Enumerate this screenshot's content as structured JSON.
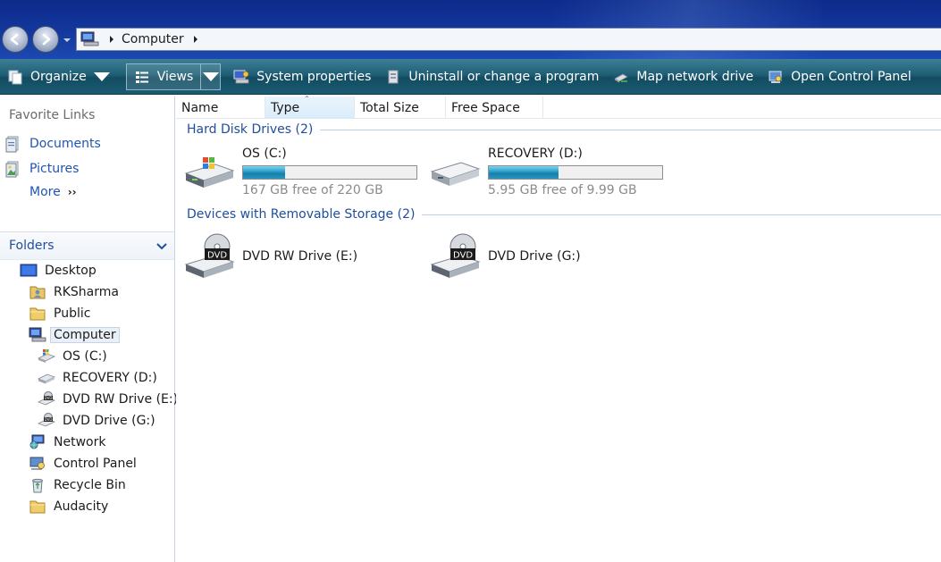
{
  "address": {
    "crumbs": [
      "Computer"
    ]
  },
  "toolbar": {
    "organize": "Organize",
    "views": "Views",
    "system_properties": "System properties",
    "uninstall": "Uninstall or change a program",
    "map_network": "Map network drive",
    "open_control_panel": "Open Control Panel"
  },
  "favorites": {
    "title": "Favorite Links",
    "items": [
      {
        "label": "Documents",
        "icon": "documents-icon"
      },
      {
        "label": "Pictures",
        "icon": "pictures-icon"
      }
    ],
    "more": "More"
  },
  "folders": {
    "title": "Folders",
    "tree": [
      {
        "label": "Desktop",
        "icon": "desktop-icon"
      },
      {
        "label": "RKSharma",
        "icon": "user-folder-icon"
      },
      {
        "label": "Public",
        "icon": "folder-icon"
      },
      {
        "label": "Computer",
        "icon": "computer-icon",
        "selected": true
      },
      {
        "label": "OS (C:)",
        "icon": "os-drive-icon"
      },
      {
        "label": "RECOVERY (D:)",
        "icon": "hard-drive-icon"
      },
      {
        "label": "DVD RW Drive (E:)",
        "icon": "dvd-drive-icon"
      },
      {
        "label": "DVD Drive (G:)",
        "icon": "dvd-drive-icon"
      },
      {
        "label": "Network",
        "icon": "network-icon"
      },
      {
        "label": "Control Panel",
        "icon": "control-panel-icon"
      },
      {
        "label": "Recycle Bin",
        "icon": "recycle-bin-icon"
      },
      {
        "label": "Audacity",
        "icon": "folder-icon"
      }
    ]
  },
  "columns": [
    "Name",
    "Type",
    "Total Size",
    "Free Space"
  ],
  "sorted_column": "Type",
  "groups": {
    "hard_disk": {
      "title": "Hard Disk Drives (2)",
      "drives": [
        {
          "name": "OS (C:)",
          "free_text": "167 GB free of 220 GB",
          "used_fraction": 0.24
        },
        {
          "name": "RECOVERY (D:)",
          "free_text": "5.95 GB free of 9.99 GB",
          "used_fraction": 0.4
        }
      ]
    },
    "removable": {
      "title": "Devices with Removable Storage (2)",
      "drives": [
        {
          "name": "DVD RW Drive (E:)",
          "icon_text": "DVD"
        },
        {
          "name": "DVD Drive (G:)",
          "icon_text": "DVD"
        }
      ]
    }
  },
  "colors": {
    "accent_link": "#1f55b3",
    "group_title": "#1f4e9a",
    "bar_fill": "#1580aa",
    "toolbar": "#1f5f76"
  }
}
